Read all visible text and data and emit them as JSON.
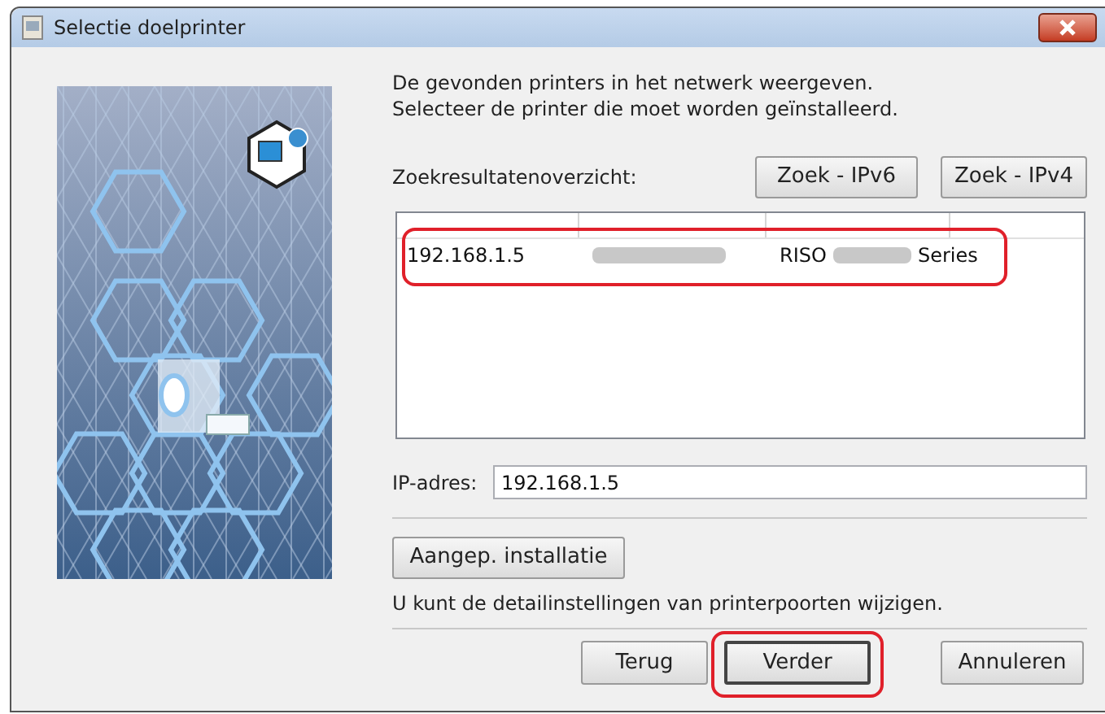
{
  "window": {
    "title": "Selectie doelprinter"
  },
  "intro": [
    "De gevonden printers in het netwerk weergeven.",
    "Selecteer de printer die moet worden geïnstalleerd."
  ],
  "search": {
    "label": "Zoekresultatenoverzicht:",
    "buttons": [
      "Zoek - IPv6",
      "Zoek - IPv4"
    ]
  },
  "results": {
    "rows": [
      {
        "ip": "192.168.1.5",
        "model_prefix": "RISO",
        "model_suffix": "Series",
        "highlighted": true
      }
    ]
  },
  "ip_field": {
    "label": "IP-adres:",
    "value": "192.168.1.5"
  },
  "custom": {
    "button": "Aangep. installatie",
    "hint": "U kunt de detailinstellingen van printerpoorten wijzigen."
  },
  "footer": [
    {
      "label": "Terug",
      "default": false,
      "highlighted": false
    },
    {
      "label": "Verder",
      "default": true,
      "highlighted": true
    },
    {
      "label": "Annuleren",
      "default": false,
      "highlighted": false
    }
  ]
}
